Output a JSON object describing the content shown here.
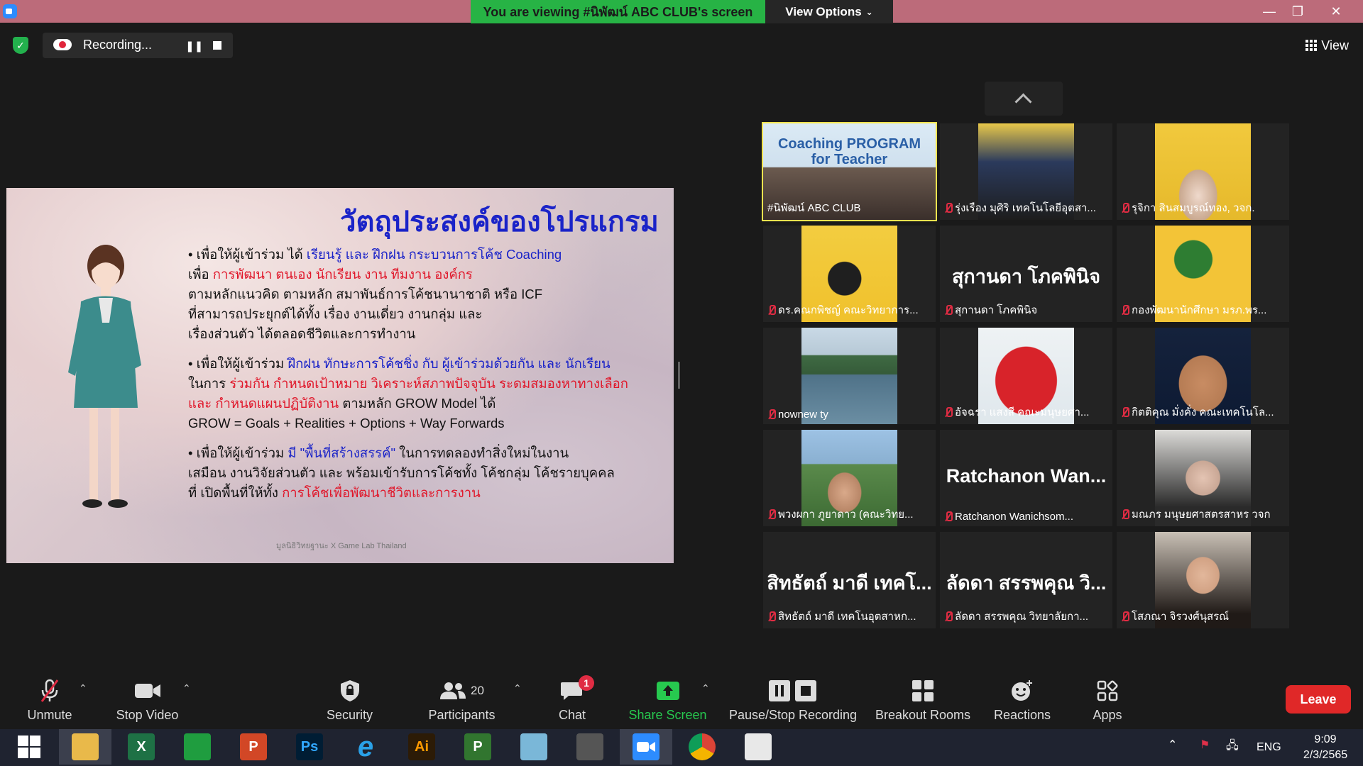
{
  "window": {
    "viewing_banner": "You are viewing #นิพัฒน์ ABC CLUB's screen",
    "view_options_label": "View Options",
    "minimize": "—",
    "restore": "❐",
    "close": "✕"
  },
  "top": {
    "recording_label": "Recording...",
    "view_label": "View"
  },
  "slide": {
    "title": "วัตถุประสงค์ของโปรแกรม",
    "p1": [
      {
        "t": "• เพื่อให้ผู้เข้าร่วม ได้ ",
        "c": ""
      },
      {
        "t": "เรียนรู้ และ ฝึกฝน กระบวนการโค้ช Coaching",
        "c": "b"
      },
      {
        "t": "\nเพื่อ ",
        "c": ""
      },
      {
        "t": "การพัฒนา ตนเอง นักเรียน งาน ทีมงาน องค์กร",
        "c": "r"
      },
      {
        "t": "\nตามหลักแนวคิด ตามหลัก สมาพันธ์การโค้ชนานาชาติ หรือ ICF\nที่สามารถประยุกต์ได้ทั้ง เรื่อง งานเดี่ยว งานกลุ่ม และ\nเรื่องส่วนตัว ได้ตลอดชีวิตและการทำงาน",
        "c": ""
      }
    ],
    "p2": [
      {
        "t": "• เพื่อให้ผู้เข้าร่วม ",
        "c": ""
      },
      {
        "t": "ฝึกฝน ทักษะการโค้ชชิ่ง กับ ผู้เข้าร่วมด้วยกัน และ นักเรียน",
        "c": "b"
      },
      {
        "t": "\nในการ ",
        "c": ""
      },
      {
        "t": "ร่วมกัน กำหนดเป้าหมาย วิเคราะห์สภาพปัจจุบัน ระดมสมองหาทางเลือก\nและ กำหนดแผนปฏิบัติงาน",
        "c": "r"
      },
      {
        "t": " ตามหลัก GROW Model ได้\nGROW = Goals + Realities + Options + Way Forwards",
        "c": ""
      }
    ],
    "p3": [
      {
        "t": "• เพื่อให้ผู้เข้าร่วม ",
        "c": ""
      },
      {
        "t": "มี \"พื้นที่สร้างสรรค์\"",
        "c": "b"
      },
      {
        "t": " ในการทดลองทำสิ่งใหม่ในงาน\nเสมือน งานวิจัยส่วนตัว และ พร้อมเข้ารับการโค้ชทั้ง โค้ชกลุ่ม โค้ชรายบุคคล\nที่ เปิดพื้นที่ให้ทั้ง ",
        "c": ""
      },
      {
        "t": "การโค้ชเพื่อพัฒนาชีวิตและการงาน",
        "c": "r"
      }
    ],
    "footer": "มูลนิธิวิทยฐานะ X Game Lab Thailand"
  },
  "participants": [
    {
      "name": "#นิพัฒน์ ABC CLUB",
      "muted": false,
      "active": true,
      "video": "coaching",
      "video_text": "Coaching PROGRAM for Teacher"
    },
    {
      "name": "รุ่งเรือง มุศิริ เทคโนโลยีอุตสา...",
      "muted": true,
      "video": "man-glasses"
    },
    {
      "name": "รุจิกา สินสมบูรณ์ทอง, วจก.",
      "muted": true,
      "video": "woman-yellow"
    },
    {
      "name": "ดร.คณกพิชญ์ คณะวิทยาการ...",
      "muted": true,
      "video": "woman-banner"
    },
    {
      "name": "สุกานดา โภคพินิจ",
      "muted": true,
      "big": "สุกานดา โภคพินิจ"
    },
    {
      "name": "กองพัฒนานักศึกษา มรภ.พร...",
      "muted": true,
      "video": "logo-gear"
    },
    {
      "name": "nownew ty",
      "muted": true,
      "video": "lake"
    },
    {
      "name": "อัจฉรา แสงสี คณะมนุษยศา...",
      "muted": true,
      "video": "angry-bird"
    },
    {
      "name": "กิตติคุณ มั่งคั่ง คณะเทคโนโล...",
      "muted": true,
      "video": "cartoon-man"
    },
    {
      "name": "พวงผกา ภูยาดาว (คณะวิทย...",
      "muted": true,
      "video": "woman-outdoor"
    },
    {
      "name": "Ratchanon Wanichsom...",
      "muted": true,
      "big": "Ratchanon  Wan..."
    },
    {
      "name": "มณภร มนุษยศาสตรสาหร วจก",
      "muted": true,
      "video": "woman-dark"
    },
    {
      "name": "สิทธัตถ์ มาดี เทคโนอุตสาหก...",
      "muted": true,
      "big": "สิทธัตถ์ มาดี เทคโ..."
    },
    {
      "name": "ลัดดา สรรพคุณ วิทยาลัยกา...",
      "muted": true,
      "big": "ลัดดา สรรพคุณ วิ..."
    },
    {
      "name": "โสภณา จิรวงศ์นุสรณ์",
      "muted": true,
      "video": "woman-portrait"
    }
  ],
  "toolbar": {
    "unmute": "Unmute",
    "stop_video": "Stop Video",
    "security": "Security",
    "participants": "Participants",
    "participants_count": "20",
    "chat": "Chat",
    "chat_badge": "1",
    "share_screen": "Share Screen",
    "pause_stop_recording": "Pause/Stop Recording",
    "breakout_rooms": "Breakout Rooms",
    "reactions": "Reactions",
    "apps": "Apps",
    "leave": "Leave"
  },
  "taskbar": {
    "apps": [
      {
        "name": "windows-start",
        "label": ""
      },
      {
        "name": "file-explorer",
        "label": ""
      },
      {
        "name": "excel",
        "label": "X"
      },
      {
        "name": "store",
        "label": ""
      },
      {
        "name": "powerpoint",
        "label": "P"
      },
      {
        "name": "photoshop",
        "label": "Ps"
      },
      {
        "name": "internet-explorer",
        "label": "e"
      },
      {
        "name": "illustrator",
        "label": "Ai"
      },
      {
        "name": "project",
        "label": "P"
      },
      {
        "name": "notes",
        "label": ""
      },
      {
        "name": "photoscape",
        "label": ""
      },
      {
        "name": "zoom",
        "label": ""
      },
      {
        "name": "chrome",
        "label": ""
      },
      {
        "name": "image-viewer",
        "label": ""
      }
    ],
    "lang": "ENG",
    "time": "9:09",
    "date": "2/3/2565"
  },
  "colors": {
    "banner_green": "#27b345",
    "titlebar_pink": "#bc6b7a",
    "active_speaker": "#f2e34f",
    "mute_red": "#e02c43",
    "leave_red": "#e02828"
  }
}
